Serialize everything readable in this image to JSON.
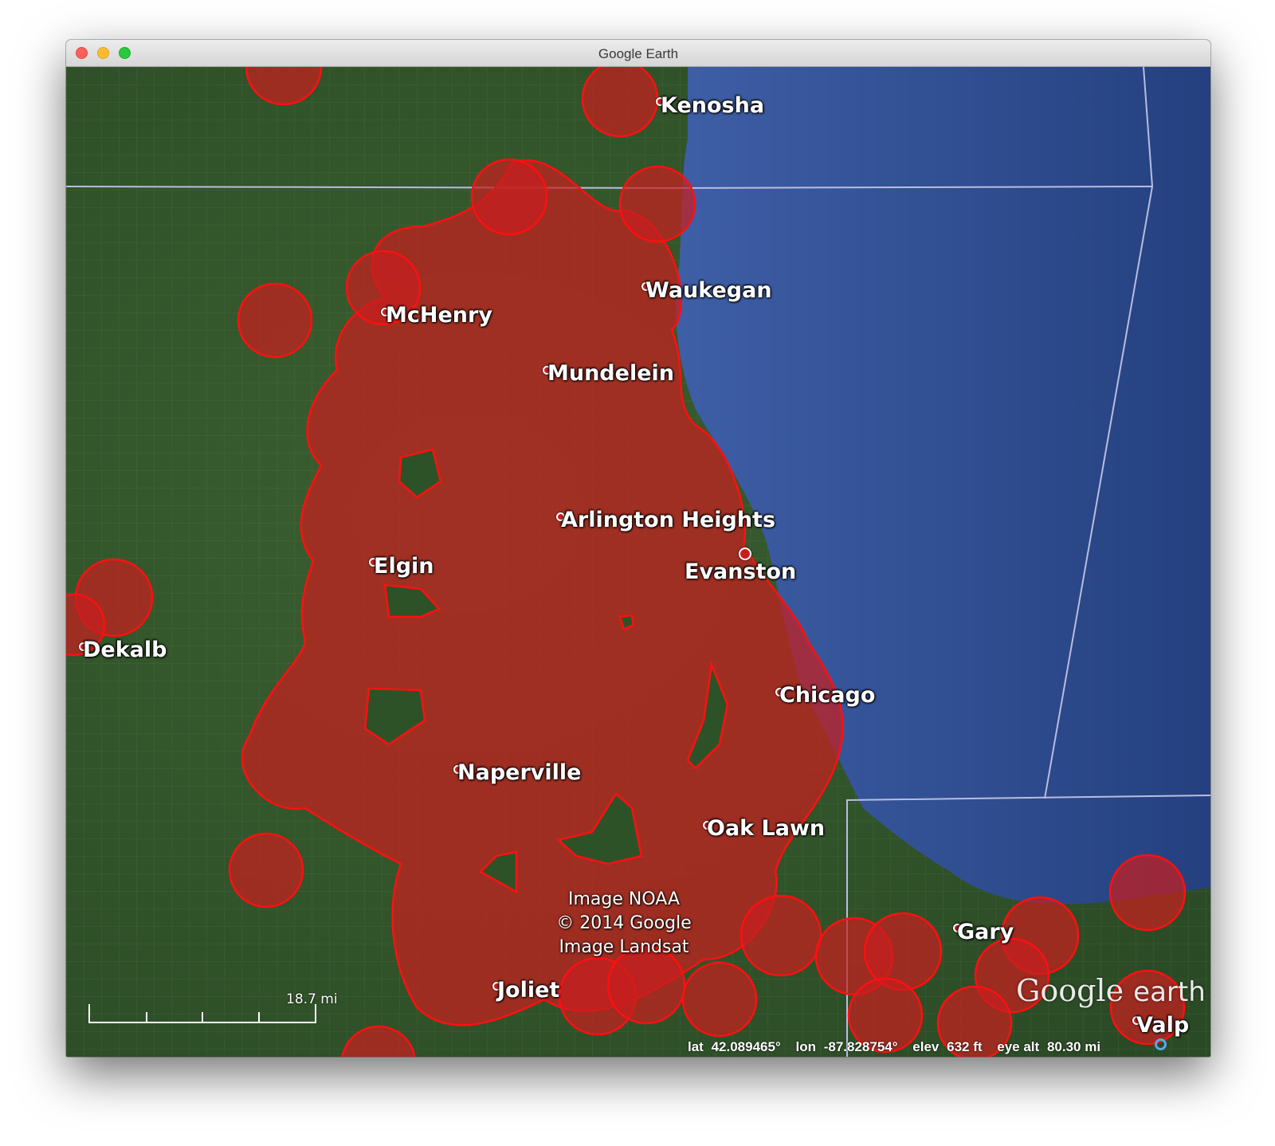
{
  "window": {
    "title": "Google Earth"
  },
  "cities": [
    {
      "name": "Kenosha"
    },
    {
      "name": "Waukegan"
    },
    {
      "name": "McHenry"
    },
    {
      "name": "Mundelein"
    },
    {
      "name": "Arlington Heights"
    },
    {
      "name": "Elgin"
    },
    {
      "name": "Evanston"
    },
    {
      "name": "Dekalb"
    },
    {
      "name": "Chicago"
    },
    {
      "name": "Naperville"
    },
    {
      "name": "Oak Lawn"
    },
    {
      "name": "Gary"
    },
    {
      "name": "Joliet"
    },
    {
      "name": "Valp"
    }
  ],
  "attribution": [
    "Image NOAA",
    "© 2014 Google",
    "Image Landsat"
  ],
  "logo": {
    "google": "Google",
    "earth": "earth"
  },
  "scale": {
    "label": "18.7 mi"
  },
  "status": {
    "lat_label": "lat",
    "lat": "42.089465°",
    "lon_label": "lon",
    "lon": "-87.828754°",
    "elev_label": "elev",
    "elev": "632 ft",
    "eye_label": "eye alt",
    "eye": "80.30 mi"
  },
  "colors": {
    "overlay_fill": "#c81e1e",
    "overlay_stroke": "#ff1010",
    "lake": "#2f4b8c",
    "land": "#2f5428"
  }
}
